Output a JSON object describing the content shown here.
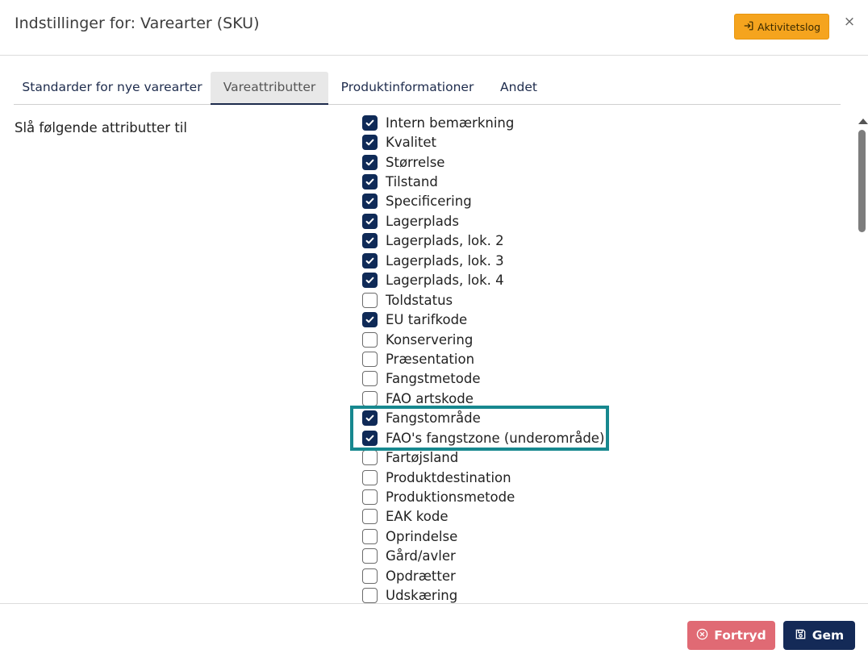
{
  "header": {
    "title": "Indstillinger for: Varearter (SKU)",
    "activity_label": "Aktivitetslog",
    "close_glyph": "×"
  },
  "tabs": [
    {
      "label": "Standarder for nye varearter",
      "active": false
    },
    {
      "label": "Vareattributter",
      "active": true
    },
    {
      "label": "Produktinformationer",
      "active": false
    },
    {
      "label": "Andet",
      "active": false
    }
  ],
  "section_label": "Slå følgende attributter til",
  "attributes": [
    {
      "label": "Intern bemærkning",
      "checked": true
    },
    {
      "label": "Kvalitet",
      "checked": true
    },
    {
      "label": "Størrelse",
      "checked": true
    },
    {
      "label": "Tilstand",
      "checked": true
    },
    {
      "label": "Specificering",
      "checked": true
    },
    {
      "label": "Lagerplads",
      "checked": true
    },
    {
      "label": "Lagerplads, lok. 2",
      "checked": true
    },
    {
      "label": "Lagerplads, lok. 3",
      "checked": true
    },
    {
      "label": "Lagerplads, lok. 4",
      "checked": true
    },
    {
      "label": "Toldstatus",
      "checked": false
    },
    {
      "label": "EU tarifkode",
      "checked": true
    },
    {
      "label": "Konservering",
      "checked": false
    },
    {
      "label": "Præsentation",
      "checked": false
    },
    {
      "label": "Fangstmetode",
      "checked": false
    },
    {
      "label": "FAO artskode",
      "checked": false
    },
    {
      "label": "Fangstområde",
      "checked": true
    },
    {
      "label": "FAO's fangstzone (underområde)",
      "checked": true
    },
    {
      "label": "Fartøjsland",
      "checked": false
    },
    {
      "label": "Produktdestination",
      "checked": false
    },
    {
      "label": "Produktionsmetode",
      "checked": false
    },
    {
      "label": "EAK kode",
      "checked": false
    },
    {
      "label": "Oprindelse",
      "checked": false
    },
    {
      "label": "Gård/avler",
      "checked": false
    },
    {
      "label": "Opdrætter",
      "checked": false
    },
    {
      "label": "Udskæring",
      "checked": false
    }
  ],
  "footer": {
    "cancel_label": "Fortryd",
    "save_label": "Gem"
  },
  "colors": {
    "activity_button": "#f5a41e",
    "checkbox_checked": "#0f2a57",
    "highlight_border": "#17888f",
    "cancel_button": "#e06a74",
    "save_button": "#142a57"
  },
  "icons": {
    "activity": "sign-in-icon",
    "close": "close-icon",
    "cancel": "cancel-circle-icon",
    "save": "floppy-disk-icon",
    "check": "checkmark-icon"
  }
}
